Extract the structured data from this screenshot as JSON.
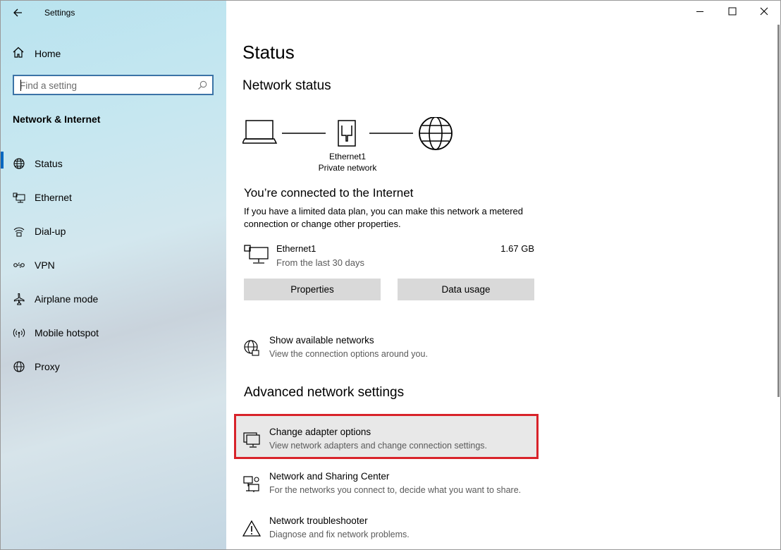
{
  "window": {
    "title": "Settings",
    "controls": [
      "minimize-icon",
      "maximize-icon",
      "close-icon"
    ]
  },
  "sidebar": {
    "home_label": "Home",
    "search_placeholder": "Find a setting",
    "section_title": "Network & Internet",
    "items": [
      {
        "label": "Status",
        "icon": "status-globe-icon",
        "active": true
      },
      {
        "label": "Ethernet",
        "icon": "ethernet-icon",
        "active": false
      },
      {
        "label": "Dial-up",
        "icon": "dialup-icon",
        "active": false
      },
      {
        "label": "VPN",
        "icon": "vpn-icon",
        "active": false
      },
      {
        "label": "Airplane mode",
        "icon": "airplane-icon",
        "active": false
      },
      {
        "label": "Mobile hotspot",
        "icon": "hotspot-icon",
        "active": false
      },
      {
        "label": "Proxy",
        "icon": "proxy-globe-icon",
        "active": false
      }
    ]
  },
  "main": {
    "title": "Status",
    "network_status_heading": "Network status",
    "diagram": {
      "adapter_name": "Ethernet1",
      "network_type": "Private network"
    },
    "connected_heading": "You’re connected to the Internet",
    "connected_desc": "If you have a limited data plan, you can make this network a metered connection or change other properties.",
    "connection": {
      "name": "Ethernet1",
      "subtitle": "From the last 30 days",
      "usage": "1.67 GB"
    },
    "buttons": {
      "properties": "Properties",
      "data_usage": "Data usage"
    },
    "show_networks": {
      "title": "Show available networks",
      "subtitle": "View the connection options around you."
    },
    "advanced_heading": "Advanced network settings",
    "advanced_items": [
      {
        "title": "Change adapter options",
        "subtitle": "View network adapters and change connection settings."
      },
      {
        "title": "Network and Sharing Center",
        "subtitle": "For the networks you connect to, decide what you want to share."
      },
      {
        "title": "Network troubleshooter",
        "subtitle": "Diagnose and fix network problems."
      }
    ]
  },
  "colors": {
    "accent": "#0067c0",
    "search_border": "#3b73a6",
    "highlight_border": "#d8232a",
    "button_bg": "#d9d9d9"
  }
}
